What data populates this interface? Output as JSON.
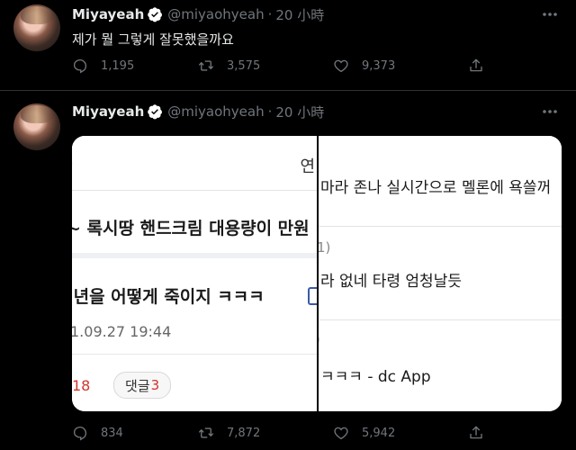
{
  "colors": {
    "background": "#000000",
    "text": "#e7e9ea",
    "muted": "#71767b",
    "verified": "#ffffff",
    "divider": "#2f3336",
    "red_count": "#d2342c"
  },
  "tweets": [
    {
      "name": "Miyayeah",
      "handle": "@miyaohyeah",
      "dot": "·",
      "time": "20 小時",
      "text": "제가 뭘 그렇게 잘못했을까요",
      "replies": "1,195",
      "retweets": "3,575",
      "likes": "9,373"
    },
    {
      "name": "Miyayeah",
      "handle": "@miyaohyeah",
      "dot": "·",
      "time": "20 小時",
      "replies": "834",
      "retweets": "7,872",
      "likes": "5,942",
      "media": {
        "left": {
          "top_paren": ")",
          "top_char": "연",
          "row1": "~ 록시땅 핸드크림 대용량이 만원",
          "post_title": ";년을 어떻게 죽이지 ㅋㅋㅋ",
          "post_date": "1.09.27 19:44",
          "num": "18",
          "comment_label": "댓글",
          "comment_count": "3"
        },
        "right": {
          "row1": "마라 존나 실시간으로 멜론에 욕쓸꺼",
          "row2_label": "1)",
          "row2": "라 없네 타령 엄청날듯",
          "row3_label": ")",
          "row3": "ㅋㅋㅋ - dc App"
        }
      }
    }
  ],
  "icons": [
    "avatar",
    "verified-icon",
    "more-icon",
    "reply-icon",
    "retweet-icon",
    "like-icon",
    "share-icon"
  ]
}
